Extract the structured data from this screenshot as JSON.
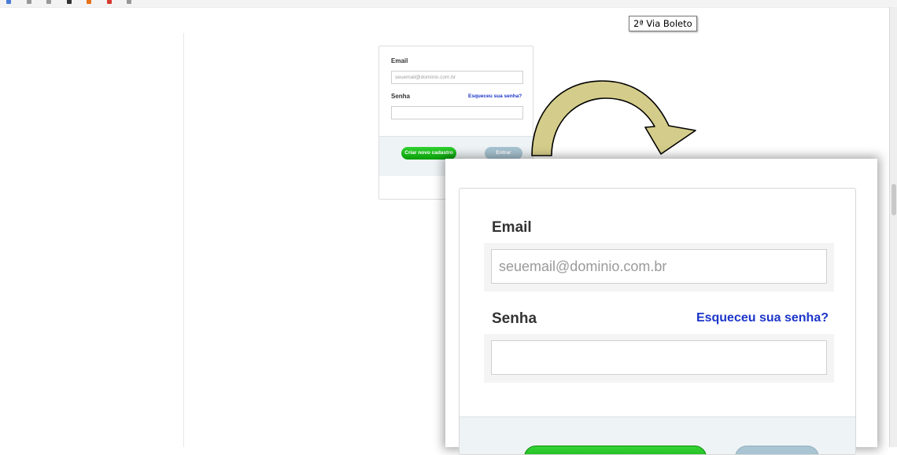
{
  "tooltip": {
    "text": "2ª Via Boleto"
  },
  "login_small": {
    "email_label": "Email",
    "email_placeholder": "seuemail@dominio.com.br",
    "password_label": "Senha",
    "forgot_link": "Esqueceu sua senha?",
    "create_button": "Criar novo cadastro",
    "login_button": "Entrar"
  },
  "login_zoom": {
    "email_label": "Email",
    "email_placeholder": "seuemail@dominio.com.br",
    "password_label": "Senha",
    "forgot_link": "Esqueceu sua senha?"
  },
  "colors": {
    "link": "#1c35c9",
    "green_button": "#0a9e0a",
    "blue_button": "#a7c3d1",
    "arrow_fill": "#d4cc8a"
  }
}
